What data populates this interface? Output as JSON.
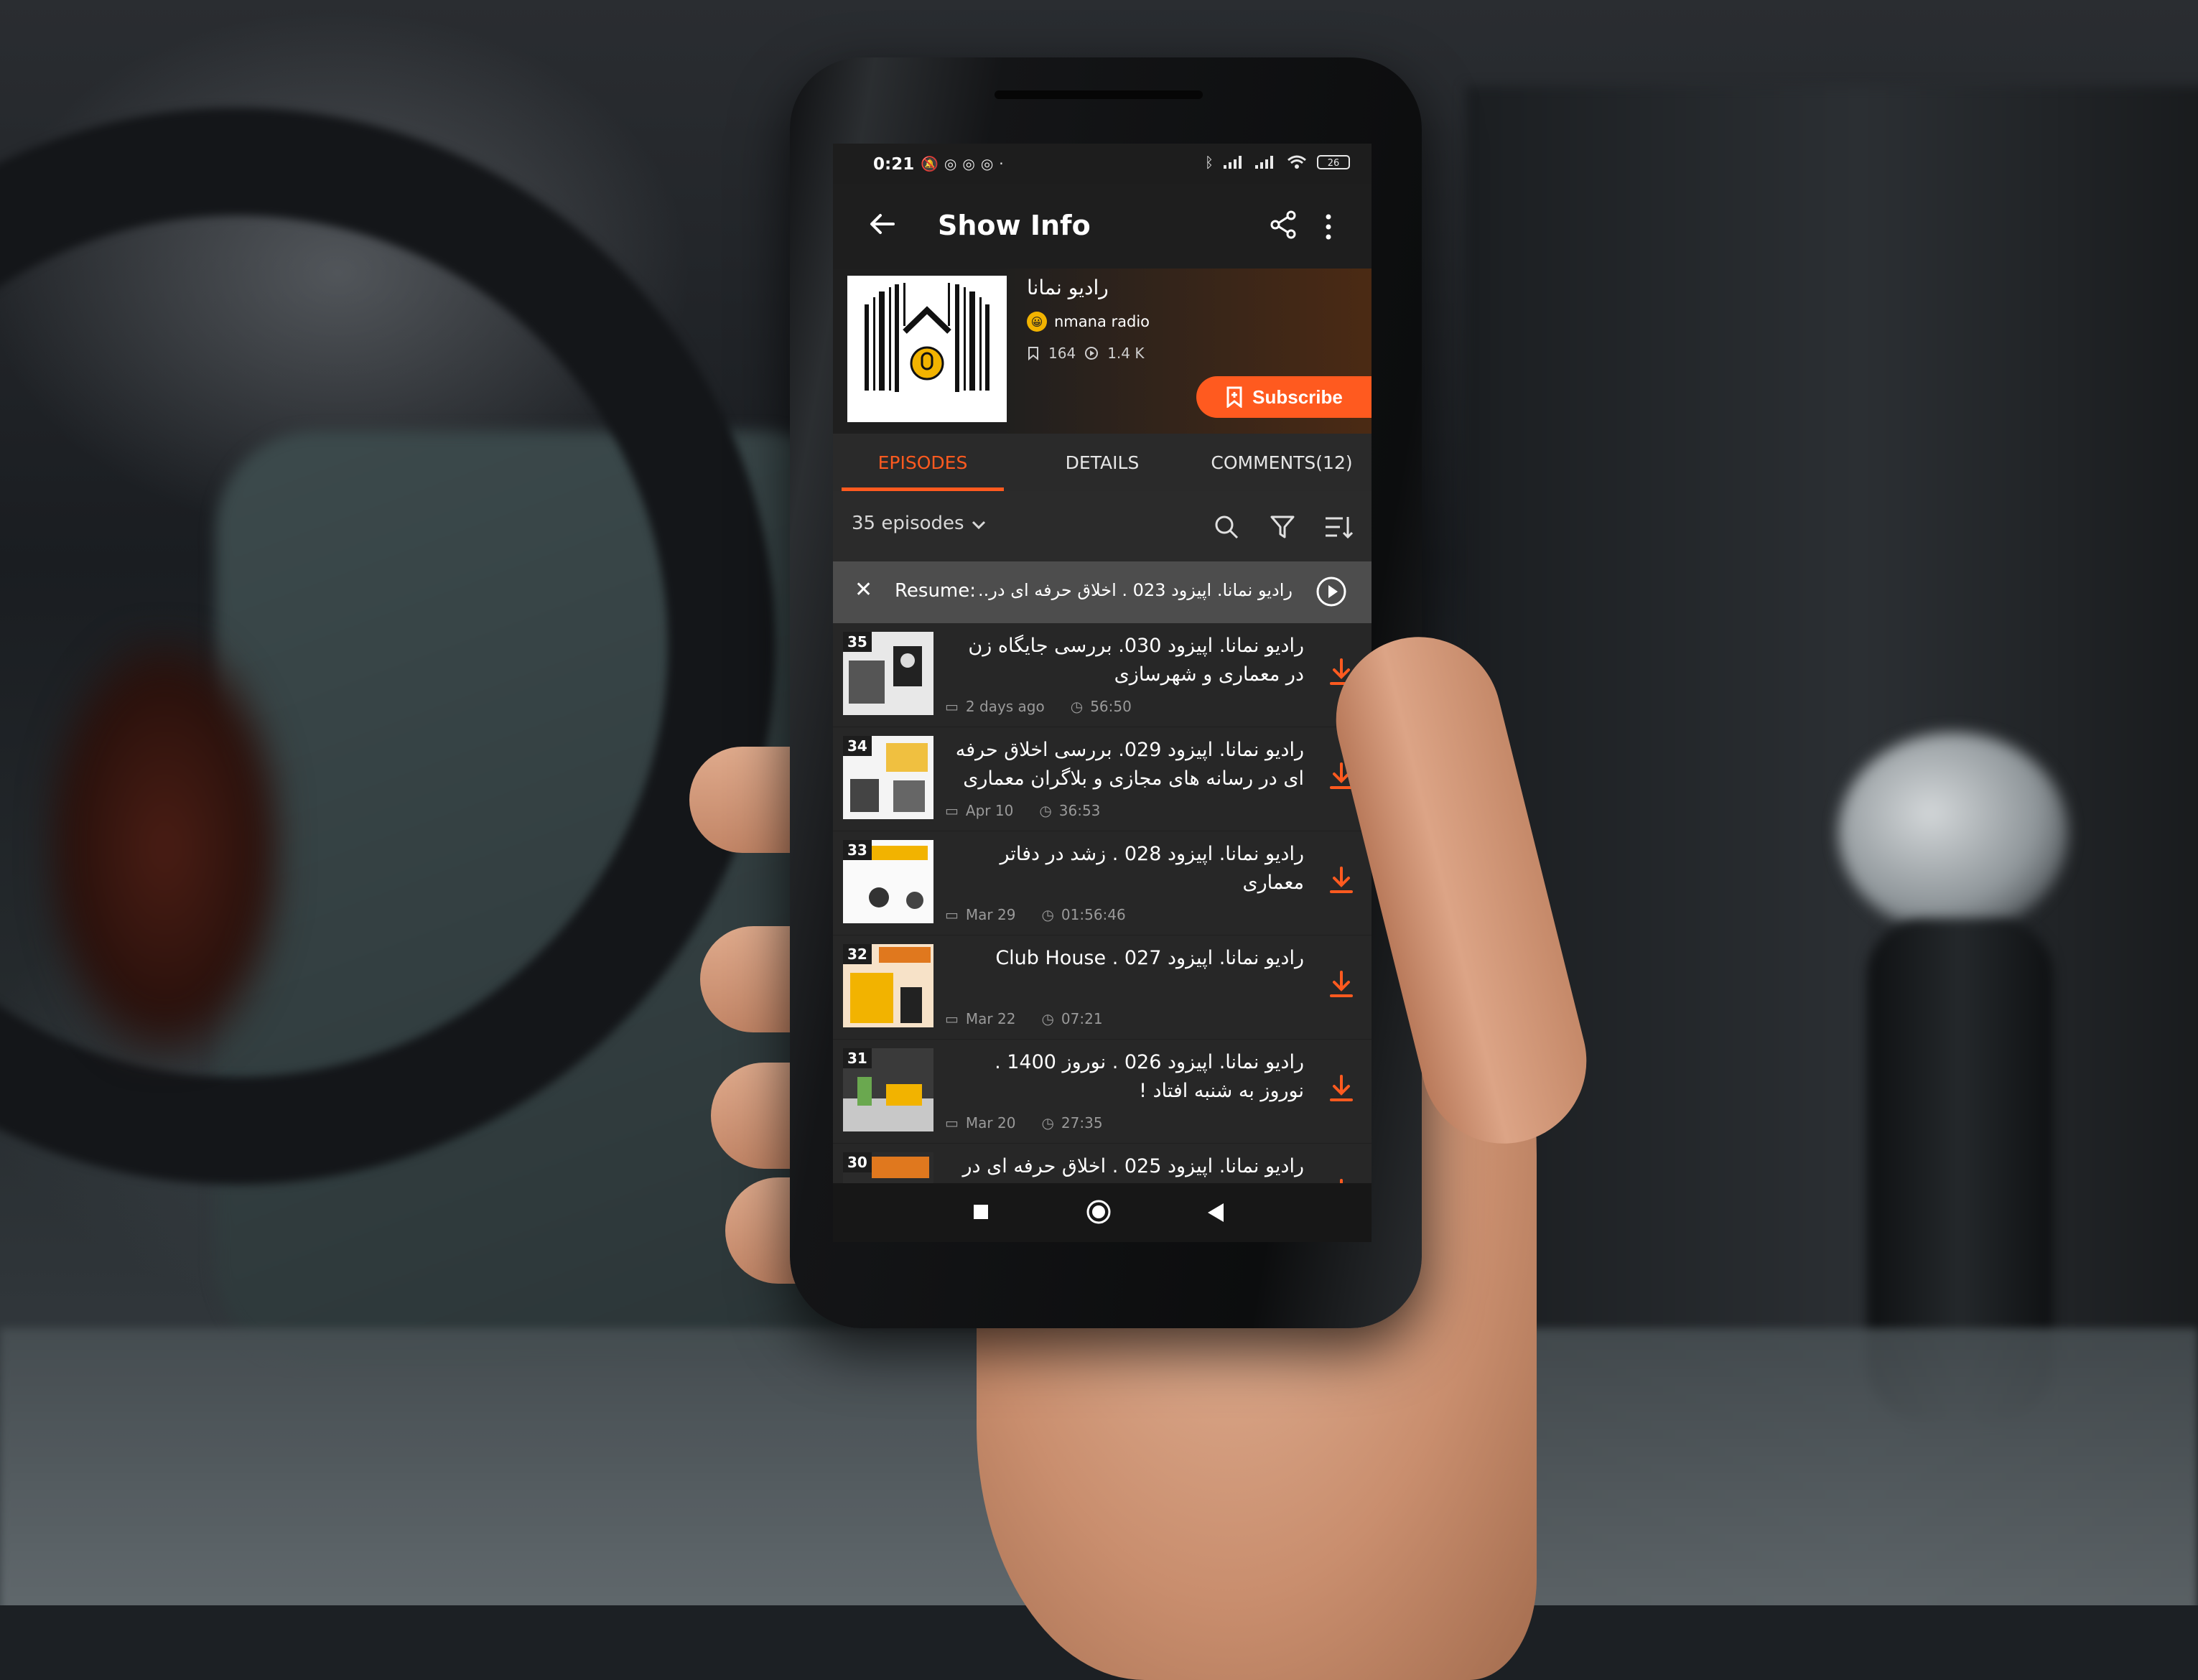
{
  "status_bar": {
    "time": "0:21",
    "battery": "26",
    "left_icons": [
      "mute-bell-icon",
      "instagram-icon",
      "instagram-icon",
      "instagram-icon",
      "dot-icon"
    ],
    "right_icons": [
      "bluetooth-icon",
      "signal-icon",
      "signal-icon",
      "wifi-icon",
      "battery-icon"
    ]
  },
  "app_bar": {
    "title": "Show Info"
  },
  "show": {
    "title": "رادیو نمانا",
    "author": "nmana radio",
    "subscribers": "164",
    "plays": "1.4 K",
    "subscribe_label": "Subscribe"
  },
  "tabs": [
    {
      "label": "EPISODES",
      "active": true
    },
    {
      "label": "DETAILS",
      "active": false
    },
    {
      "label": "COMMENTS(12)",
      "active": false
    }
  ],
  "list_toolbar": {
    "episode_count": "35 episodes"
  },
  "resume": {
    "label": "Resume:",
    "text": "رادیو نمانا. اپیزود 023 . اخلاق حرفه ای در..."
  },
  "episodes": [
    {
      "number": "35",
      "title": "رادیو نمانا. اپیزود 030. بررسی جایگاه زن در معماری و شهرسازی",
      "date": "2 days ago",
      "duration": "56:50"
    },
    {
      "number": "34",
      "title": "رادیو نمانا. اپیزود 029. بررسی اخلاق حرفه ای در رسانه های مجازی و  بلاگران معماری",
      "date": "Apr 10",
      "duration": "36:53"
    },
    {
      "number": "33",
      "title": "رادیو نمانا. اپیزود 028 . زشد در دفاتر معماری",
      "date": "Mar 29",
      "duration": "01:56:46"
    },
    {
      "number": "32",
      "title": "رادیو نمانا. اپیزود 027 . Club House",
      "date": "Mar 22",
      "duration": "07:21"
    },
    {
      "number": "31",
      "title": "رادیو نمانا. اپیزود 026 . نوروز 1400 . نوروز به شنبه افتاد !",
      "date": "Mar 20",
      "duration": "27:35"
    },
    {
      "number": "30",
      "title": "رادیو نمانا. اپیزود 025 . اخلاق حرفه ای در",
      "date": "",
      "duration": ""
    }
  ],
  "colors": {
    "accent": "#ff5a1f",
    "background": "#272727",
    "appbar": "#1e1e1e"
  }
}
